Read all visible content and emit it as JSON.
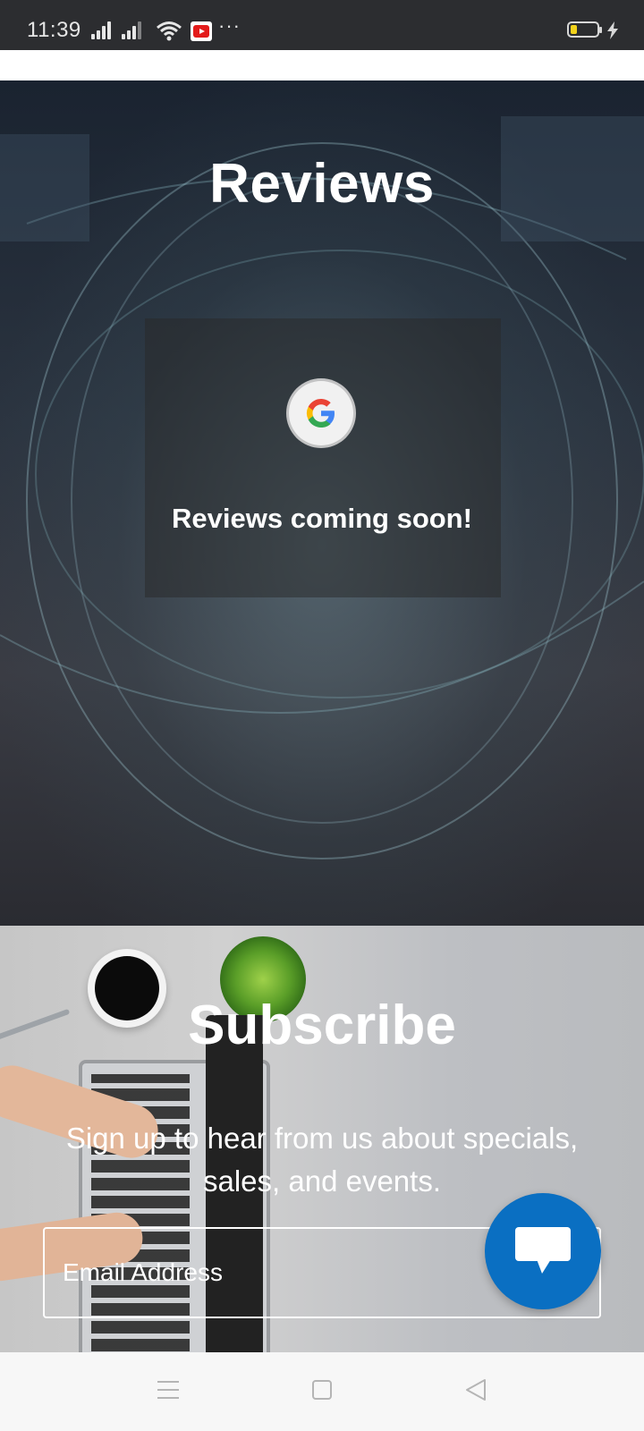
{
  "status_bar": {
    "time": "11:39",
    "overflow": "···",
    "icons": [
      "signal-icon",
      "signal-icon",
      "wifi-icon",
      "youtube-icon",
      "battery-icon",
      "charging-icon"
    ],
    "battery_color": "#f2d21b"
  },
  "reviews": {
    "title": "Reviews",
    "message": "Reviews coming soon!",
    "badge_icon": "google-icon"
  },
  "subscribe": {
    "title": "Subscribe",
    "description": "Sign up to hear from us about specials, sales, and events.",
    "email_placeholder": "Email Address"
  },
  "chat": {
    "icon": "chat-icon",
    "color": "#0a6fc2"
  },
  "nav_bar": {
    "buttons": [
      "menu-icon",
      "home-icon",
      "back-icon"
    ]
  }
}
